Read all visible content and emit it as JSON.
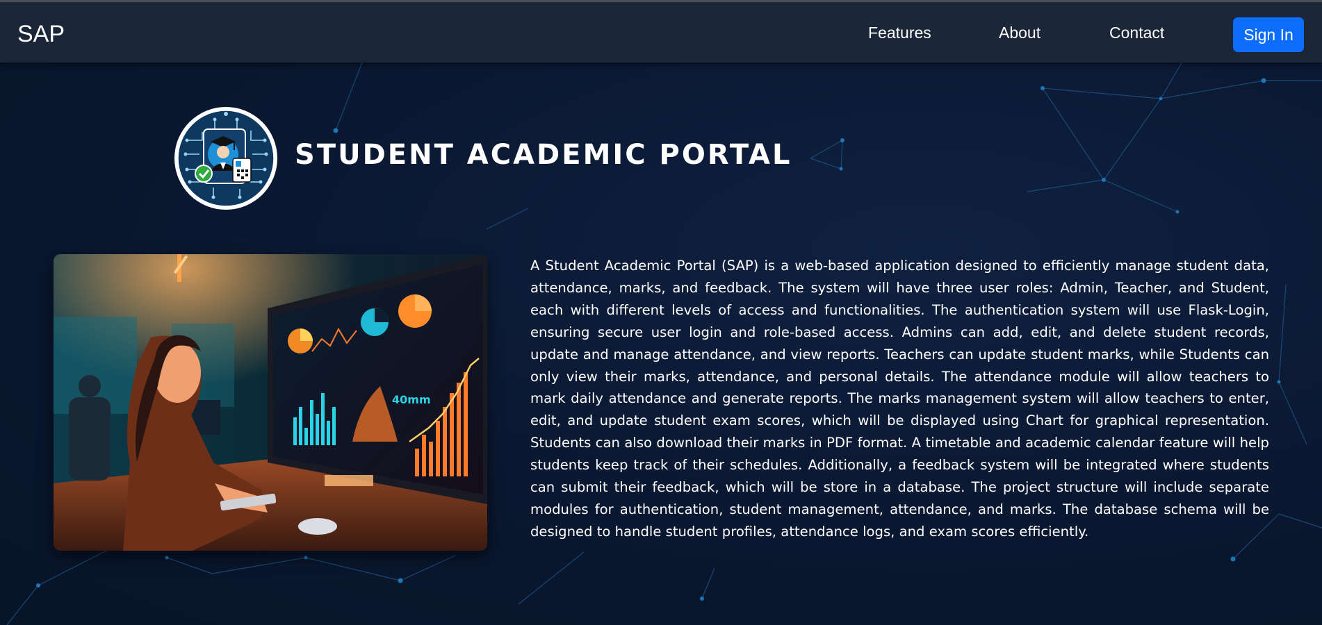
{
  "navbar": {
    "brand": "SAP",
    "links": [
      "Features",
      "About",
      "Contact"
    ],
    "signin_label": "Sign In"
  },
  "header": {
    "title": "STUDENT ACADEMIC PORTAL",
    "logo_icon": "graduate-circuit-logo"
  },
  "hero_image": {
    "icon": "student-dashboard-illustration",
    "screen_label": "40mm"
  },
  "description": "A Student Academic Portal (SAP) is a web-based application designed to efficiently manage student data, attendance, marks, and feedback. The system will have three user roles: Admin, Teacher, and Student, each with different levels of access and functionalities. The authentication system will use Flask-Login, ensuring secure user login and role-based access. Admins can add, edit, and delete student records, update and manage attendance, and view reports. Teachers can update student marks, while Students can only view their marks, attendance, and personal details. The attendance module will allow teachers to mark daily attendance and generate reports. The marks management system will allow teachers to enter, edit, and update student exam scores, which will be displayed using Chart for graphical representation. Students can also download their marks in PDF format. A timetable and academic calendar feature will help students keep track of their schedules. Additionally, a feedback system will be integrated where students can submit their feedback, which will be store in a database. The project structure will include separate modules for authentication, student management, attendance, and marks. The database schema will be designed to handle student profiles, attendance logs, and exam scores efficiently.",
  "colors": {
    "background": "#0a1830",
    "navbar": "#1b2638",
    "accent": "#0d6efd",
    "text": "#ffffff"
  }
}
